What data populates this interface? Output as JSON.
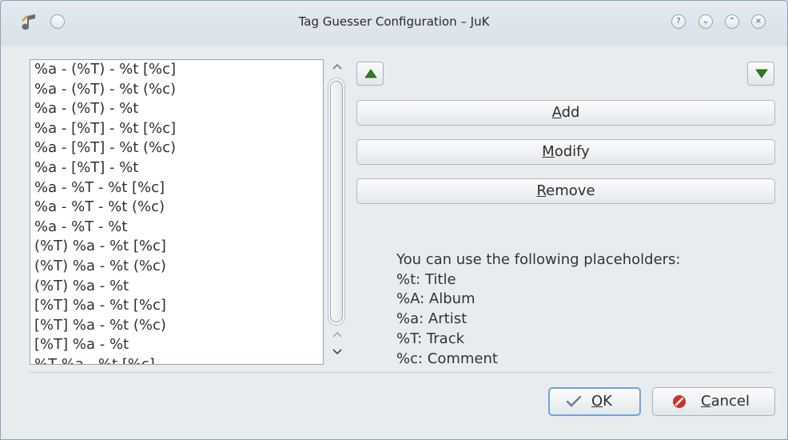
{
  "window": {
    "title": "Tag Guesser Configuration – JuK",
    "help_glyph": "?",
    "minimize_glyph": "⌄",
    "maximize_glyph": "⌃",
    "close_glyph": "×"
  },
  "schemes": [
    "%a - (%T) - %t [%c]",
    "%a - (%T) - %t (%c)",
    "%a - (%T) - %t",
    "%a - [%T] - %t [%c]",
    "%a - [%T] - %t (%c)",
    "%a - [%T] - %t",
    "%a - %T - %t [%c]",
    "%a - %T - %t (%c)",
    "%a - %T - %t",
    "(%T) %a - %t [%c]",
    "(%T) %a - %t (%c)",
    "(%T) %a - %t",
    "[%T] %a - %t [%c]",
    "[%T] %a - %t (%c)",
    "[%T] %a - %t",
    "%T %a - %t [%c]"
  ],
  "buttons": {
    "add": {
      "mnemonic": "A",
      "rest": "dd"
    },
    "modify": {
      "mnemonic": "M",
      "rest": "odify"
    },
    "remove": {
      "mnemonic": "R",
      "rest": "emove"
    },
    "ok": {
      "mnemonic": "O",
      "rest": "K"
    },
    "cancel": {
      "mnemonic": "C",
      "rest": "ancel"
    }
  },
  "placeholders": {
    "heading": "You can use the following placeholders:",
    "items": [
      "%t: Title",
      "%A: Album",
      "%a: Artist",
      "%T: Track",
      "%c: Comment"
    ]
  },
  "colors": {
    "arrow_green": "#2f7d1f",
    "ok_focus": "#6fa4d6",
    "cancel_red": "#d0322b"
  }
}
